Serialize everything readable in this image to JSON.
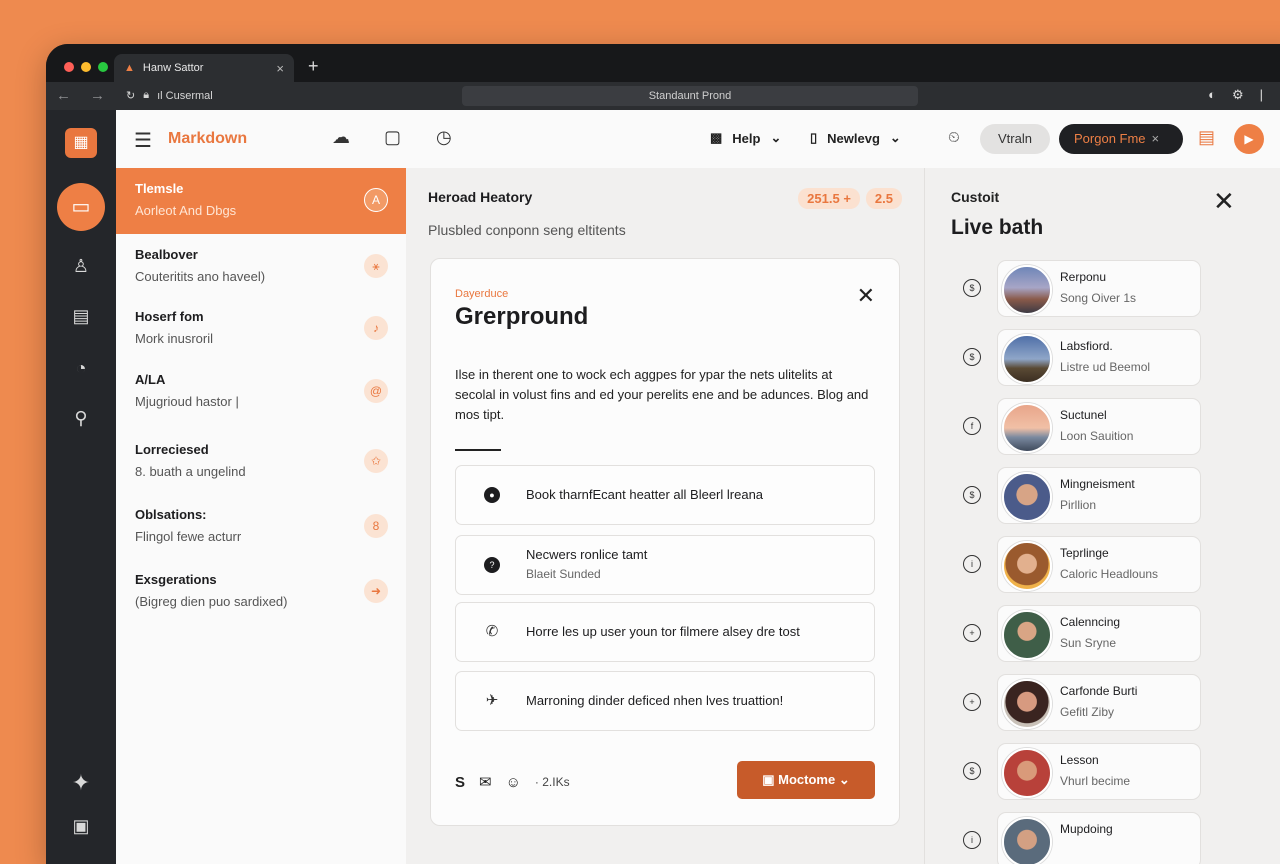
{
  "browser": {
    "tab_title": "Hanw Sattor",
    "tab_close": "×",
    "new_tab": "+",
    "back": "←",
    "forward": "→",
    "addr_prefix": "ıl Cusermal",
    "url": "Standaunt Prond"
  },
  "header": {
    "app_title": "Markdown",
    "help_label": "Help",
    "nav_label": "Newlevg",
    "pill_grey": "Vtraln",
    "pill_dark": "Porgon Fme",
    "pill_dark_close": "×"
  },
  "list": {
    "items": [
      {
        "title": "Tlemsle",
        "sub": "Aorleot And Dbgs",
        "icon": "A",
        "active": true
      },
      {
        "title": "Bealbover",
        "sub": "Couteritits ano haveel)",
        "icon": "⚹"
      },
      {
        "title": "Hoserf fom",
        "sub": "Mork inusroril",
        "icon": "♪"
      },
      {
        "title": "A/LA",
        "sub": "Mjugrioud hastor |",
        "icon": "@"
      },
      {
        "title": "Lorreciesed",
        "sub": "8. buath a ungelind",
        "icon": "✩"
      },
      {
        "title": "Oblsations:",
        "sub": "Flingol fewe acturr",
        "icon": "8"
      },
      {
        "title": "Exsgerations",
        "sub": "(Bigreg dien puo sardixed)",
        "icon": "➜"
      }
    ]
  },
  "main": {
    "title": "Heroad Heatory",
    "subtitle": "Plusbled conponn seng eltitents",
    "stat1": "251.5 +",
    "stat2": "2.5",
    "card": {
      "eyebrow": "Dayerduce",
      "title": "Grerpround",
      "close": "✕",
      "body": "Ilse in therent one to wock ech aggpes for ypar the nets ulitelits at secolal in volust fins and ed your perelits ene and be adunces. Blog and mos tipt.",
      "rows": [
        {
          "text": "Book tharnfEcant heatter all Bleerl lreana"
        },
        {
          "title": "Necwers ronlice tamt",
          "sub": "Blaeit Sunded"
        },
        {
          "text": "Horre les up user youn tor filmere alsey dre tost"
        },
        {
          "text": "Marroning dinder deficed nhen lves truattion!"
        }
      ],
      "footer_count": "· 2.IKs",
      "primary_button": "Moctome"
    }
  },
  "right": {
    "eyebrow": "Custoit",
    "title": "Live bath",
    "people": [
      {
        "name": "Rerponu",
        "sub": "Song Oiver 1s",
        "ctrl": "$"
      },
      {
        "name": "Labsfiord.",
        "sub": "Listre ud Beemol",
        "ctrl": "$"
      },
      {
        "name": "Suctunel",
        "sub": "Loon Sauition",
        "ctrl": "f"
      },
      {
        "name": "Mingneisment",
        "sub": "Pirllion",
        "ctrl": "$"
      },
      {
        "name": "Teprlinge",
        "sub": "Caloric Headlouns",
        "ctrl": "i"
      },
      {
        "name": "Calenncing",
        "sub": "Sun Sryne",
        "ctrl": "+"
      },
      {
        "name": "Carfonde Burti",
        "sub": "Gefitl Ziby",
        "ctrl": "+"
      },
      {
        "name": "Lesson",
        "sub": "Vhurl becime",
        "ctrl": "$"
      },
      {
        "name": "Mupdoing",
        "sub": "",
        "ctrl": "i"
      }
    ]
  },
  "colors": {
    "accent": "#ee7f45",
    "accent_dark": "#c75b2a",
    "rail": "#24262a"
  },
  "icons": {
    "rail": [
      "logo-icon",
      "window-icon",
      "user-icon",
      "clipboard-icon",
      "history-icon",
      "search-icon",
      "sparkle-icon",
      "bot-icon"
    ],
    "header": [
      "menu-icon",
      "cloud-icon",
      "tablet-icon",
      "clock-icon",
      "gift-icon",
      "chevron-down-icon",
      "note-icon",
      "chevron-down-icon",
      "timer-icon",
      "document-icon",
      "play-icon"
    ]
  }
}
